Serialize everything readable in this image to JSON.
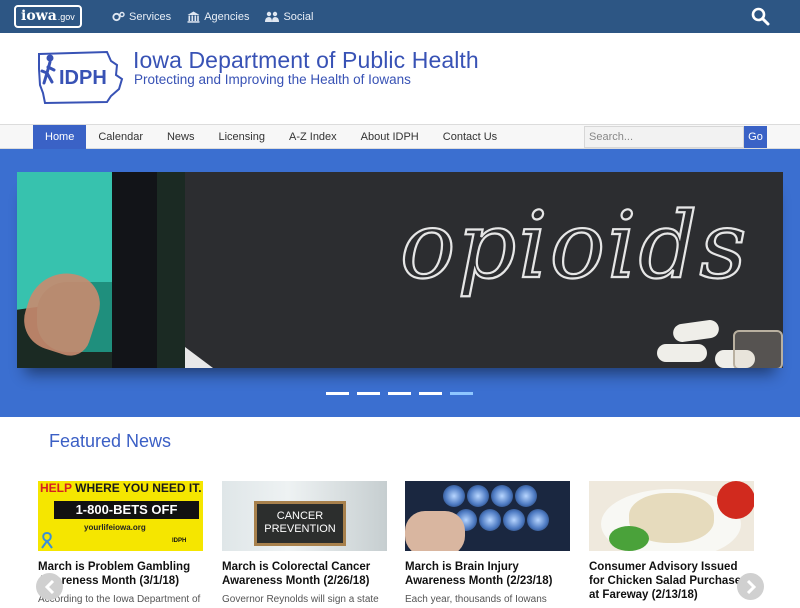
{
  "topbar": {
    "logo_main": "iowa",
    "logo_suffix": ".gov",
    "links": [
      {
        "label": "Services",
        "icon": "gears-icon"
      },
      {
        "label": "Agencies",
        "icon": "building-icon"
      },
      {
        "label": "Social",
        "icon": "people-icon"
      }
    ]
  },
  "header": {
    "logo_text": "IDPH",
    "title": "Iowa Department of Public Health",
    "subtitle": "Protecting and Improving the Health of Iowans"
  },
  "nav": {
    "items": [
      "Home",
      "Calendar",
      "News",
      "Licensing",
      "A-Z Index",
      "About IDPH",
      "Contact Us"
    ],
    "active_index": 0,
    "search_placeholder": "Search...",
    "go_label": "Go"
  },
  "hero": {
    "slide_text": "opioids",
    "slide_count": 5,
    "active_slide": 5
  },
  "featured": {
    "heading": "Featured News",
    "cards": [
      {
        "title": "March is Problem Gambling Awareness Month (3/1/18)",
        "snippet": "According to the Iowa Department of",
        "image": {
          "line1_red": "HELP",
          "line1_rest": " WHERE YOU NEED IT.",
          "line2": "1-800-BETS OFF",
          "line3": "yourlifeiowa.org",
          "mark": "IDPH"
        }
      },
      {
        "title": "March is Colorectal Cancer Awareness Month (2/26/18)",
        "snippet": "Governor Reynolds will sign a state",
        "image": {
          "sign_line1": "CANCER",
          "sign_line2": "PREVENTION"
        }
      },
      {
        "title": "March is Brain Injury Awareness Month (2/23/18)",
        "snippet": "Each year, thousands of Iowans",
        "image": {}
      },
      {
        "title": "Consumer Advisory Issued for Chicken Salad Purchased at Fareway (2/13/18)",
        "snippet": "",
        "image": {}
      }
    ]
  },
  "colors": {
    "topbar": "#2d5684",
    "brand_blue": "#3852b5",
    "nav_active": "#3a62c6",
    "hero_bg": "#3b6fd0",
    "dot_active": "#8ec6ff"
  }
}
